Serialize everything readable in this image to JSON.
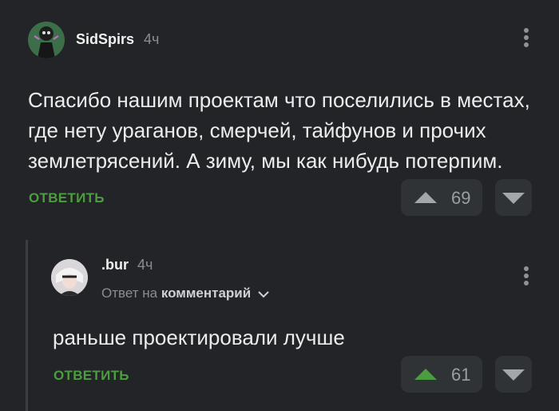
{
  "comment1": {
    "username": "SidSpirs",
    "time": "4ч",
    "text_lines": [
      "Спасибо нашим проектам что поселились в местах,",
      "где нету ураганов, смерчей, тайфунов и прочих",
      "землетрясений. А зиму, мы как нибудь потерпим."
    ],
    "reply_label": "ОТВЕТИТЬ",
    "rating": "69",
    "upvote_color": "#a3a6aa"
  },
  "comment2": {
    "username": ".bur",
    "time": "4ч",
    "reply_to_prefix": "Ответ на",
    "reply_to_target": "комментарий",
    "text": "раньше проектировали лучше",
    "reply_label": "ОТВЕТИТЬ",
    "rating": "61",
    "upvote_color": "#4c9d3f"
  },
  "icons": {
    "menu": "kebab-menu-icon",
    "upvote": "triangle-up-icon",
    "downvote": "triangle-down-icon",
    "expand": "chevron-down-icon"
  }
}
